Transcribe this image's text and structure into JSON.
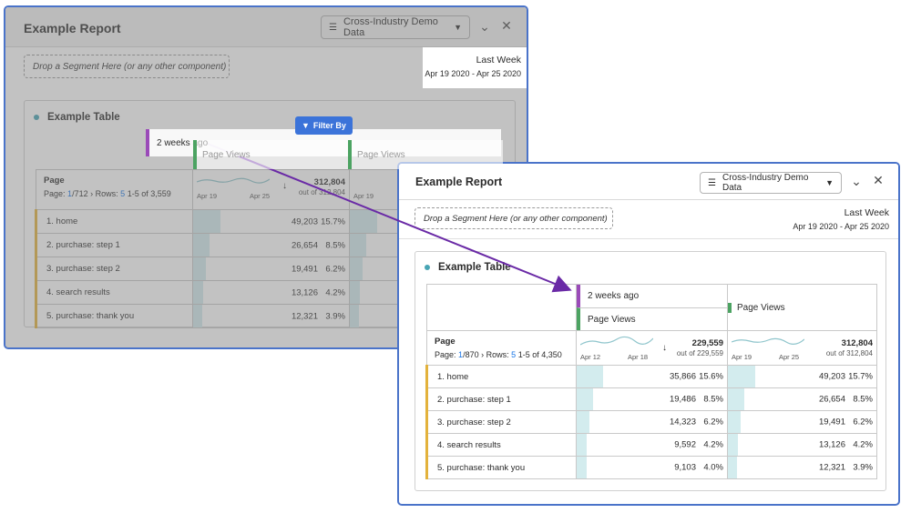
{
  "back": {
    "title": "Example Report",
    "datasource": "Cross-Industry Demo Data",
    "segment_drop": "Drop a Segment Here (or any other component)",
    "date_label": "Last Week",
    "date_range": "Apr 19 2020 - Apr 25 2020",
    "card_title": "Example Table",
    "ghost_segment": "2 weeks ago",
    "filter_label": "Filter By",
    "col_header": "Page Views",
    "col_header_2": "Page Views",
    "dim_name": "Page",
    "pager": {
      "prefix": "Page:",
      "page": "1",
      "of_pages": "/712",
      "rows_label": "Rows:",
      "rows": "5",
      "range": "1-5 of 3,559"
    },
    "ticks": [
      "Apr 19",
      "Apr 25"
    ],
    "ticks_2": [
      "Apr 19"
    ],
    "total": "312,804",
    "total_of": "out of 312,804",
    "rows": [
      {
        "label": "1. home",
        "value": "49,203",
        "pct": "15.7%",
        "frac": 0.157
      },
      {
        "label": "2. purchase: step 1",
        "value": "26,654",
        "pct": "8.5%",
        "frac": 0.085
      },
      {
        "label": "3. purchase: step 2",
        "value": "19,491",
        "pct": "6.2%",
        "frac": 0.062
      },
      {
        "label": "4. search results",
        "value": "13,126",
        "pct": "4.2%",
        "frac": 0.042
      },
      {
        "label": "5. purchase: thank you",
        "value": "12,321",
        "pct": "3.9%",
        "frac": 0.039
      }
    ]
  },
  "front": {
    "title": "Example Report",
    "datasource": "Cross-Industry Demo Data",
    "segment_drop": "Drop a Segment Here (or any other component)",
    "date_label": "Last Week",
    "date_range": "Apr 19 2020 - Apr 25 2020",
    "card_title": "Example Table",
    "seg_col": {
      "segment": "2 weeks ago",
      "metric": "Page Views"
    },
    "pv_col": {
      "metric": "Page Views"
    },
    "dim_name": "Page",
    "pager": {
      "prefix": "Page:",
      "page": "1",
      "of_pages": "/870",
      "rows_label": "Rows:",
      "rows": "5",
      "range": "1-5 of 4,350"
    },
    "col1": {
      "ticks": [
        "Apr 12",
        "Apr 18"
      ],
      "total": "229,559",
      "total_of": "out of 229,559"
    },
    "col2": {
      "ticks": [
        "Apr 19",
        "Apr 25"
      ],
      "total": "312,804",
      "total_of": "out of 312,804"
    },
    "rows": [
      {
        "label": "1. home",
        "v1": "35,866",
        "p1": "15.6%",
        "f1": 0.156,
        "v2": "49,203",
        "p2": "15.7%",
        "f2": 0.157
      },
      {
        "label": "2. purchase: step 1",
        "v1": "19,486",
        "p1": "8.5%",
        "f1": 0.085,
        "v2": "26,654",
        "p2": "8.5%",
        "f2": 0.085
      },
      {
        "label": "3. purchase: step 2",
        "v1": "14,323",
        "p1": "6.2%",
        "f1": 0.062,
        "v2": "19,491",
        "p2": "6.2%",
        "f2": 0.062
      },
      {
        "label": "4. search results",
        "v1": "9,592",
        "p1": "4.2%",
        "f1": 0.042,
        "v2": "13,126",
        "p2": "4.2%",
        "f2": 0.042
      },
      {
        "label": "5. purchase: thank you",
        "v1": "9,103",
        "p1": "4.0%",
        "f1": 0.04,
        "v2": "12,321",
        "p2": "3.9%",
        "f2": 0.039
      }
    ]
  },
  "icons": {
    "database": "database-icon",
    "chevron": "chevron-down-icon",
    "close": "close-icon",
    "sort": "sort-down-icon",
    "filter": "funnel-icon"
  },
  "colors": {
    "panel_border": "#4a73c9",
    "segment": "#9a4ab8",
    "metric": "#4ca362",
    "row_marker": "#e3b23c",
    "bar": "#d3ecee",
    "arrow": "#6a2aa6"
  }
}
